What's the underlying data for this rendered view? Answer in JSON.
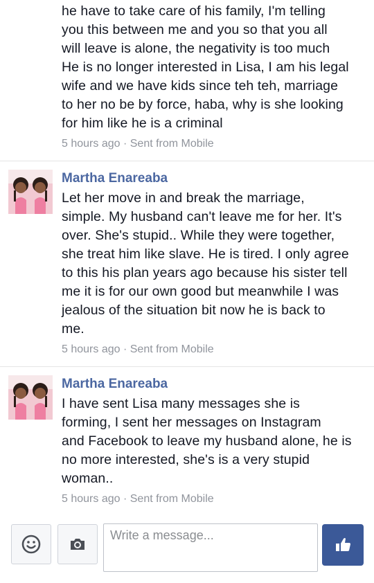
{
  "messages": [
    {
      "author": "",
      "text": "he have to take care of his family, I'm telling\nyou this between me and you so that you all\nwill leave is alone, the negativity is too much\nHe is no longer interested in Lisa, I am his legal\nwife and we have kids since teh teh, marriage\nto her no be by force, haba, why is she looking\nfor him like he is a criminal",
      "time": "5 hours ago",
      "separator": "·",
      "source": "Sent from Mobile"
    },
    {
      "author": "Martha Enareaba",
      "text": "Let her move in and break the marriage,\nsimple. My husband can't leave me for her. It's\nover. She's stupid.. While they were together,\nshe treat him like slave. He is tired. I only agree\nto this his plan years ago because his sister tell\nme it is for our own good but meanwhile I was\njealous of the situation bit now he is back to\nme.",
      "time": "5 hours ago",
      "separator": "·",
      "source": "Sent from Mobile"
    },
    {
      "author": "Martha Enareaba",
      "text": "I have sent Lisa many messages she is\nforming, I sent her messages on Instagram\nand Facebook to leave my husband alone, he is\nno more interested, she's is a very stupid\nwoman..",
      "time": "5 hours ago",
      "separator": "·",
      "source": "Sent from Mobile"
    }
  ],
  "composer": {
    "placeholder": "Write a message...",
    "emoji_icon": "smiley-icon",
    "camera_icon": "camera-icon",
    "like_icon": "thumbs-up-icon"
  },
  "colors": {
    "author": "#4b67a1",
    "meta": "#90949c",
    "like_button": "#3b5998"
  }
}
